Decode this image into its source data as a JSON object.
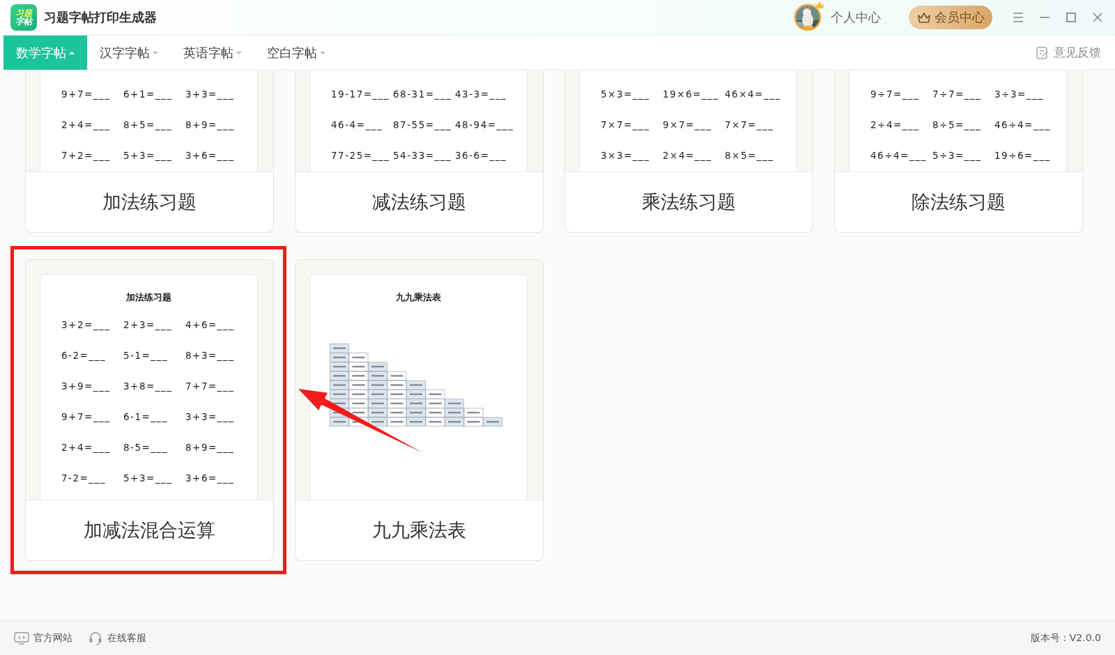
{
  "app": {
    "logo_lines": [
      "习题",
      "字帖"
    ],
    "title": "习题字帖打印生成器"
  },
  "user": {
    "label": "个人中心"
  },
  "vip_button": {
    "label": "会员中心"
  },
  "tabs": [
    {
      "label": "数学字帖",
      "selected": true
    },
    {
      "label": "汉字字帖",
      "selected": false
    },
    {
      "label": "英语字帖",
      "selected": false
    },
    {
      "label": "空白字帖",
      "selected": false
    }
  ],
  "feedback": {
    "label": "意见反馈"
  },
  "cards": [
    {
      "kind": "problems",
      "title": "加法练习题",
      "highlighted": false,
      "problems": [
        [
          "9+7=___",
          "6+1=___",
          "3+3=___"
        ],
        [
          "2+4=___",
          "8+5=___",
          "8+9=___"
        ],
        [
          "7+2=___",
          "5+3=___",
          "3+6=___"
        ]
      ]
    },
    {
      "kind": "problems",
      "title": "减法练习题",
      "highlighted": false,
      "problems": [
        [
          "19-17=___",
          "68-31=___",
          "43-3=___"
        ],
        [
          "46-4=___",
          "87-55=___",
          "48-94=___"
        ],
        [
          "77-25=___",
          "54-33=___",
          "36-6=___"
        ]
      ]
    },
    {
      "kind": "problems",
      "title": "乘法练习题",
      "highlighted": false,
      "problems": [
        [
          "5×3=___",
          "19×6=___",
          "46×4=___"
        ],
        [
          "7×7=___",
          "9×7=___",
          "7×7=___"
        ],
        [
          "3×3=___",
          "2×4=___",
          "8×5=___"
        ]
      ]
    },
    {
      "kind": "problems",
      "title": "除法练习题",
      "highlighted": false,
      "problems": [
        [
          "9÷7=___",
          "7÷7=___",
          "3÷3=___"
        ],
        [
          "2÷4=___",
          "8÷5=___",
          "46÷4=___"
        ],
        [
          "46÷4=___",
          "5÷3=___",
          "19÷6=___"
        ]
      ]
    },
    {
      "kind": "problems",
      "title": "加减法混合运算",
      "highlighted": true,
      "paper_title": "加法练习题",
      "problems": [
        [
          "3+2=___",
          "2+3=___",
          "4+6=___"
        ],
        [
          "6-2=___",
          "5-1=___",
          "8+3=___"
        ],
        [
          "3+9=___",
          "3+8=___",
          "7+7=___"
        ],
        [
          "9+7=___",
          "6-1=___",
          "3+3=___"
        ],
        [
          "2+4=___",
          "8-5=___",
          "8+9=___"
        ],
        [
          "7-2=___",
          "5+3=___",
          "3+6=___"
        ]
      ]
    },
    {
      "kind": "table",
      "title": "九九乘法表",
      "highlighted": false,
      "paper_title": "九九乘法表"
    }
  ],
  "footer": {
    "links": [
      "官方网站",
      "在线客服"
    ],
    "version": "版本号：V2.0.0"
  }
}
